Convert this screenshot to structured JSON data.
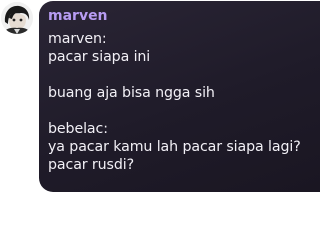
{
  "message": {
    "username": "marven",
    "avatar_icon": "profile-avatar",
    "accent_color": "#b79cf2",
    "bubble_color": "#221e2c",
    "lines": [
      "marven:",
      "pacar siapa ini",
      "",
      "buang aja bisa ngga sih",
      "",
      "bebelac:",
      "ya pacar kamu lah pacar siapa lagi?",
      "pacar rusdi?"
    ]
  }
}
